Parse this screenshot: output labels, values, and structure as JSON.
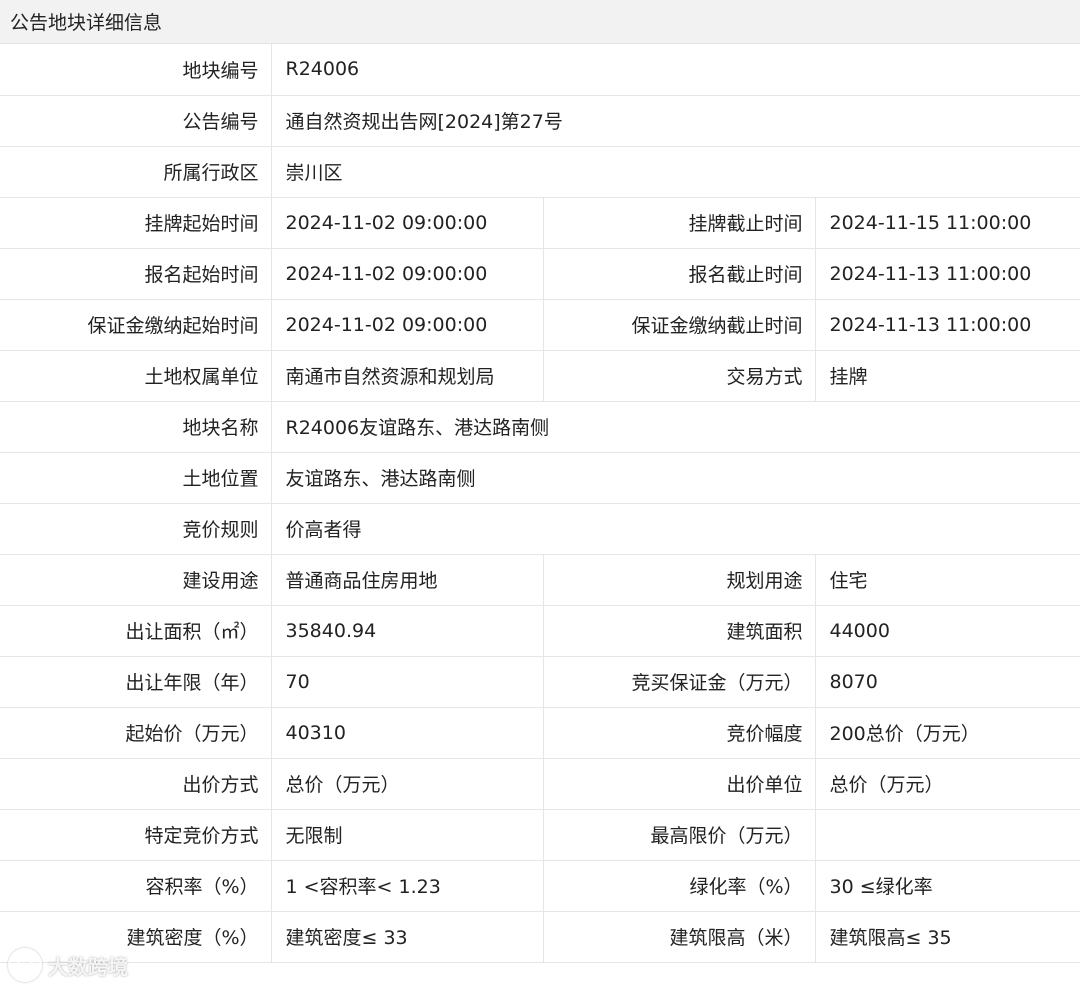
{
  "header": {
    "title": "公告地块详细信息"
  },
  "rows": [
    {
      "l1": "地块编号",
      "v1": "R24006"
    },
    {
      "l1": "公告编号",
      "v1": "通自然资规出告网[2024]第27号"
    },
    {
      "l1": "所属行政区",
      "v1": "崇川区"
    },
    {
      "l1": "挂牌起始时间",
      "v1": "2024-11-02 09:00:00",
      "l2": "挂牌截止时间",
      "v2": "2024-11-15 11:00:00"
    },
    {
      "l1": "报名起始时间",
      "v1": "2024-11-02 09:00:00",
      "l2": "报名截止时间",
      "v2": "2024-11-13 11:00:00"
    },
    {
      "l1": "保证金缴纳起始时间",
      "v1": "2024-11-02 09:00:00",
      "l2": "保证金缴纳截止时间",
      "v2": "2024-11-13 11:00:00"
    },
    {
      "l1": "土地权属单位",
      "v1": "南通市自然资源和规划局",
      "l2": "交易方式",
      "v2": "挂牌"
    },
    {
      "l1": "地块名称",
      "v1": "R24006友谊路东、港达路南侧"
    },
    {
      "l1": "土地位置",
      "v1": "友谊路东、港达路南侧"
    },
    {
      "l1": "竞价规则",
      "v1": "价高者得"
    },
    {
      "l1": "建设用途",
      "v1": "普通商品住房用地",
      "l2": "规划用途",
      "v2": "住宅"
    },
    {
      "l1": "出让面积（㎡）",
      "v1": "35840.94",
      "l2": "建筑面积",
      "v2": "44000"
    },
    {
      "l1": "出让年限（年）",
      "v1": "70",
      "l2": "竞买保证金（万元）",
      "v2": "8070"
    },
    {
      "l1": "起始价（万元）",
      "v1": "40310",
      "l2": "竞价幅度",
      "v2": "200总价（万元）"
    },
    {
      "l1": "出价方式",
      "v1": "总价（万元）",
      "l2": "出价单位",
      "v2": "总价（万元）"
    },
    {
      "l1": "特定竞价方式",
      "v1": "无限制",
      "l2": "最高限价（万元）",
      "v2": ""
    },
    {
      "l1": "容积率（%）",
      "v1": "1 <容积率< 1.23",
      "l2": "绿化率（%）",
      "v2": "30 ≤绿化率"
    },
    {
      "l1": "建筑密度（%）",
      "v1": "建筑密度≤ 33",
      "l2": "建筑限高（米）",
      "v2": "建筑限高≤ 35"
    }
  ],
  "watermark": {
    "text": "大数跨境"
  }
}
